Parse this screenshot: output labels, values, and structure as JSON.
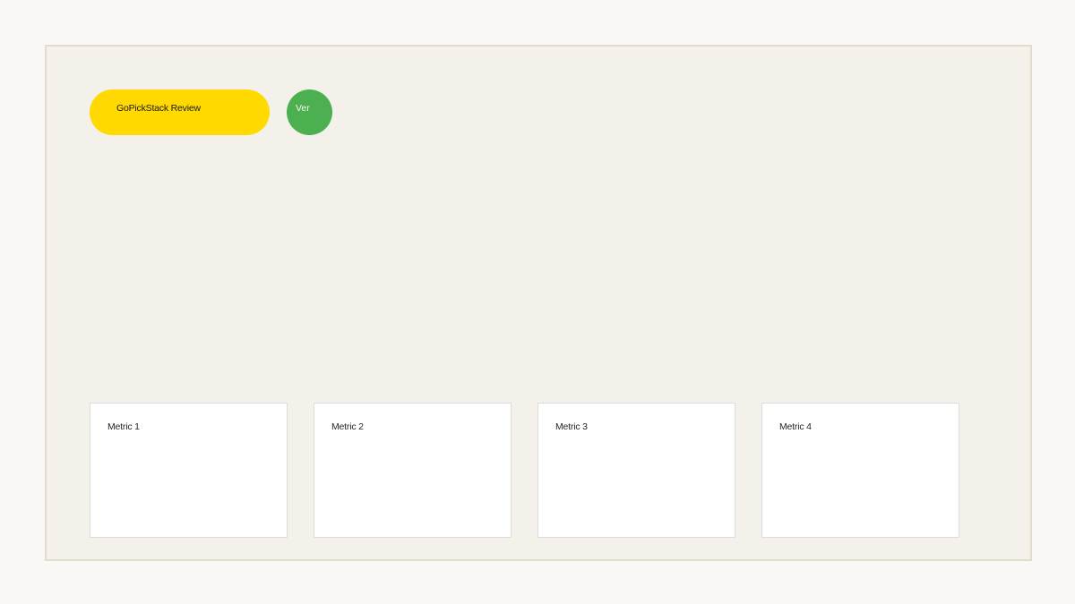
{
  "header": {
    "title_pill": "GoPickStack Review",
    "version_badge": "Ver"
  },
  "colors": {
    "pill": "#ffd900",
    "badge": "#4caf50",
    "panel": "#f3f1e9",
    "panel_border": "#e2dccd",
    "card_bg": "#ffffff"
  },
  "metrics": [
    {
      "label": "Metric 1"
    },
    {
      "label": "Metric 2"
    },
    {
      "label": "Metric 3"
    },
    {
      "label": "Metric 4"
    }
  ]
}
